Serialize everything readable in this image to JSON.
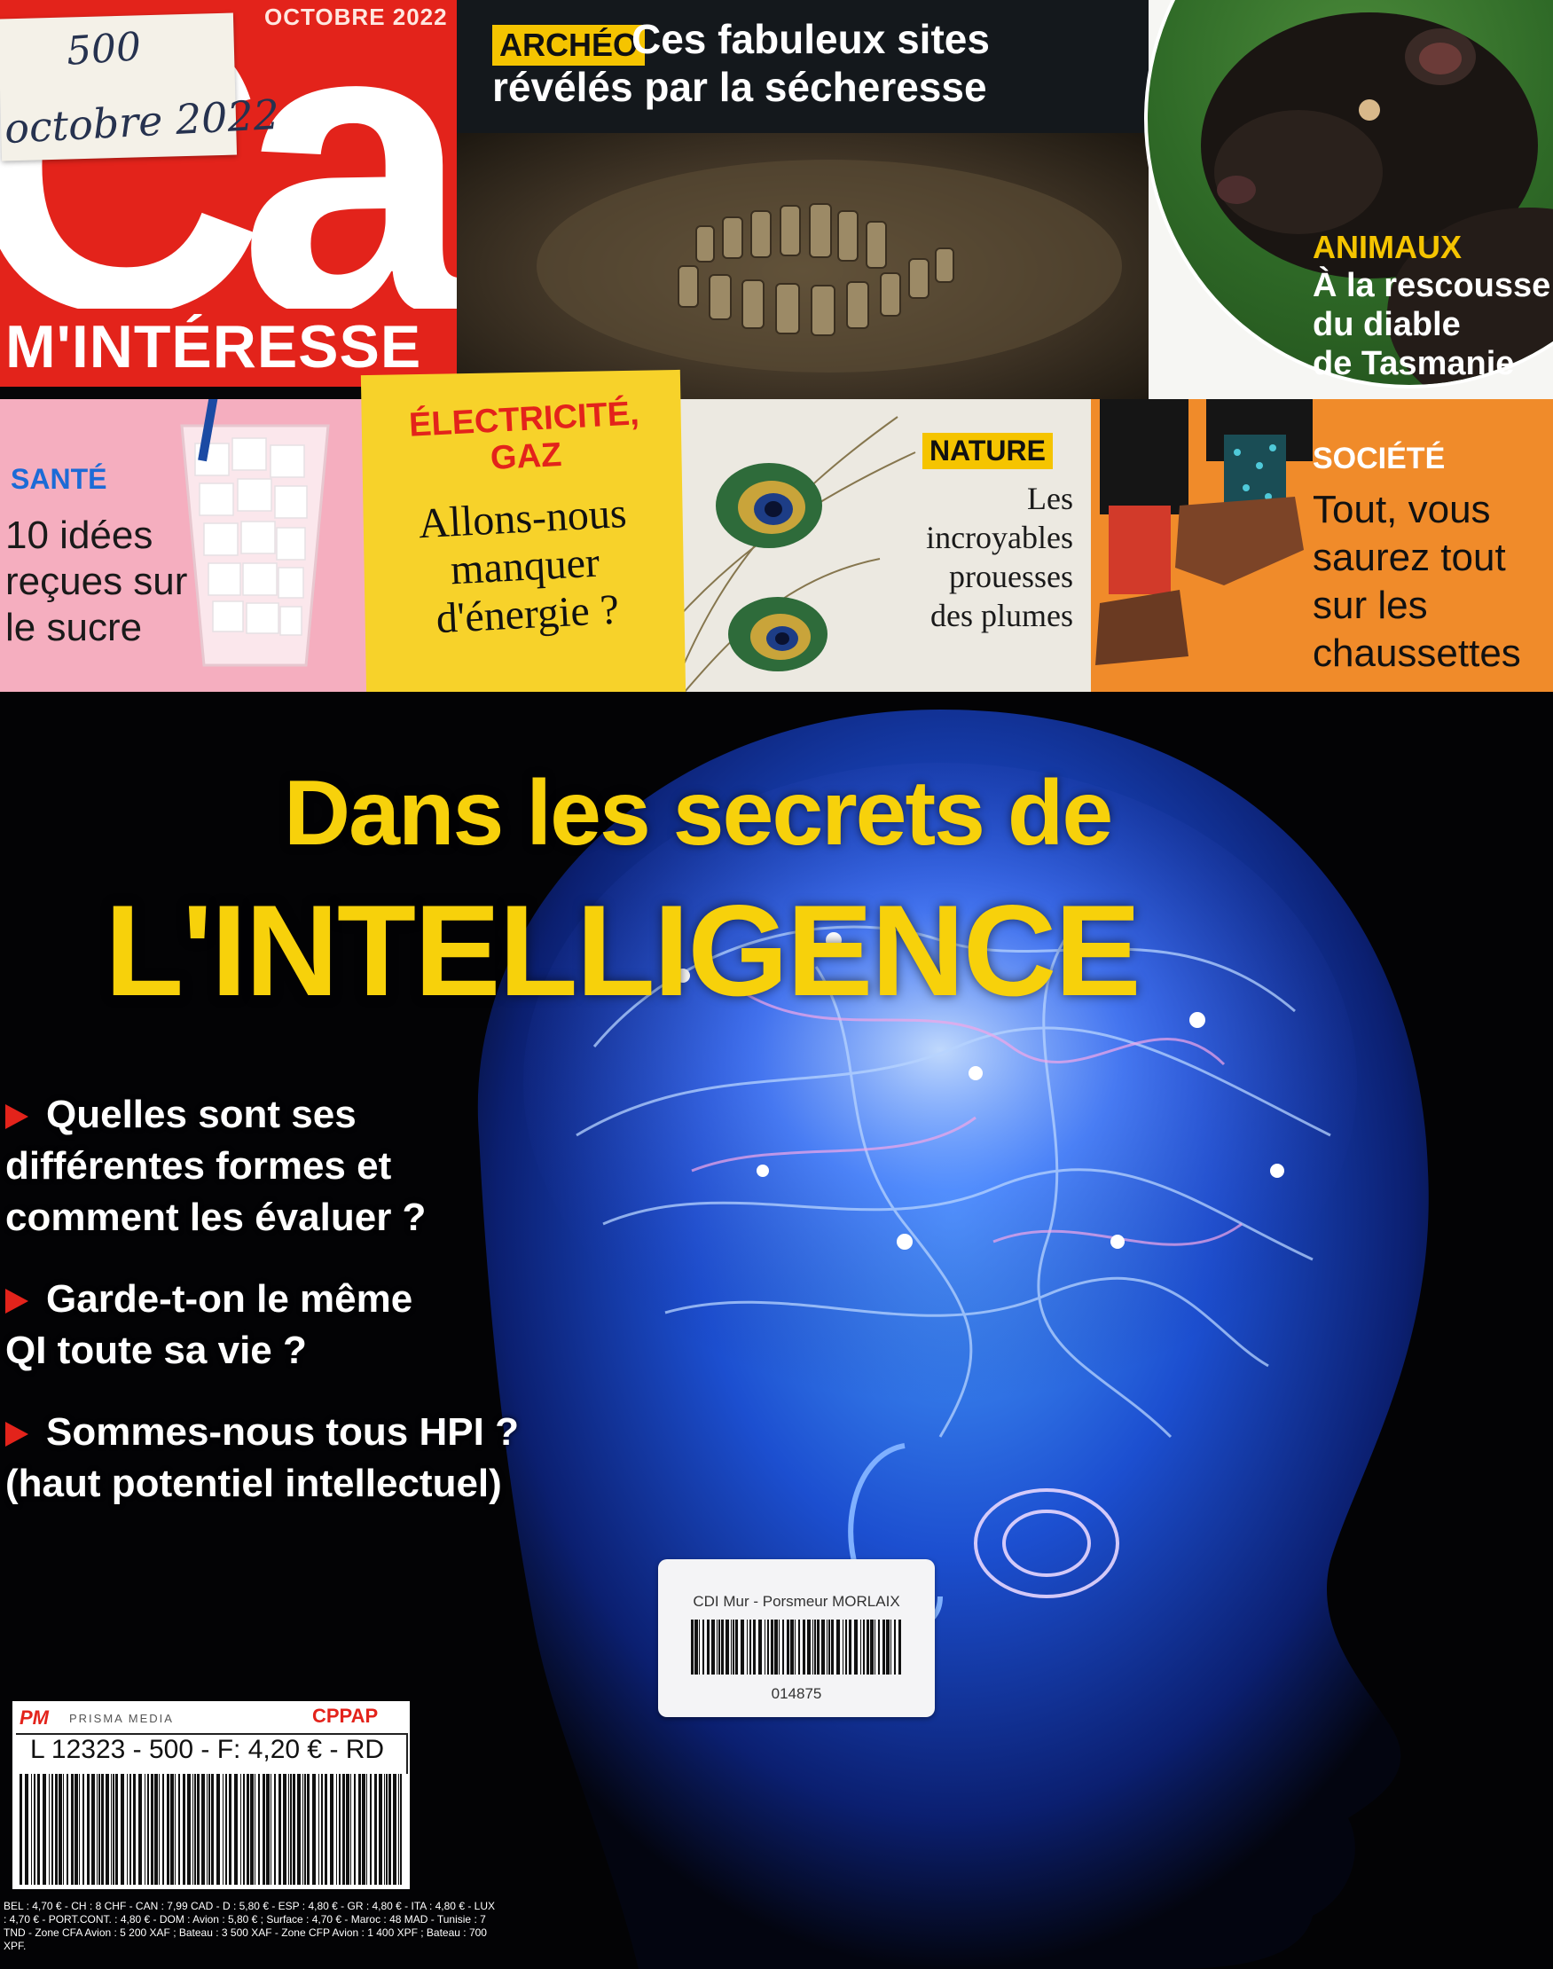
{
  "magazine": {
    "logo_letters": "Ça",
    "logo_sub": "M'INTÉRESSE",
    "issue_date": "OCTOBRE 2022"
  },
  "sticker": {
    "line1": "500",
    "line2": "octobre 2022"
  },
  "archeo": {
    "tag": "ARCHÉO",
    "title_line1": "Ces fabuleux sites",
    "title_line2": "révélés par la sécheresse"
  },
  "animaux": {
    "tag": "ANIMAUX",
    "lines": [
      "À la rescousse",
      "du diable",
      "de Tasmanie"
    ]
  },
  "sante": {
    "tag": "SANTÉ",
    "lines": [
      "10 idées",
      "reçues sur",
      "le sucre"
    ]
  },
  "electricite": {
    "tag_lines": [
      "ÉLECTRICITÉ,",
      "GAZ"
    ],
    "lines": [
      "Allons-nous",
      "manquer",
      "d'énergie ?"
    ]
  },
  "nature": {
    "tag": "NATURE",
    "lines": [
      "Les",
      "incroyables",
      "prouesses",
      "des plumes"
    ]
  },
  "societe": {
    "tag": "SOCIÉTÉ",
    "lines": [
      "Tout, vous",
      "saurez tout",
      "sur les",
      "chaussettes"
    ]
  },
  "headline": {
    "line1": "Dans les secrets de",
    "line2": "L'INTELLIGENCE"
  },
  "bullets": [
    {
      "lines": [
        "Quelles sont ses",
        "différentes formes et",
        "comment les évaluer ?"
      ]
    },
    {
      "lines": [
        "Garde-t-on le même",
        "QI toute sa vie ?"
      ]
    },
    {
      "lines": [
        "Sommes-nous tous HPI ?",
        "(haut potentiel intellectuel)"
      ]
    }
  ],
  "cdi_label": {
    "title": "CDI Mur - Porsmeur MORLAIX",
    "number": "014875"
  },
  "publisher_box": {
    "logo": "PM",
    "name": "PRISMA MEDIA",
    "cppap": "CPPAP",
    "price_line": "L 12323 - 500 - F: 4,20 € - RD"
  },
  "price_list": {
    "text": "BEL : 4,70 € - CH : 8 CHF - CAN : 7,99 CAD - D : 5,80 € - ESP : 4,80 € - GR : 4,80 € - ITA : 4,80 € - LUX : 4,70 € - PORT.CONT. : 4,80 € - DOM : Avion : 5,80 € ; Surface : 4,70 € - Maroc : 48 MAD - Tunisie : 7 TND - Zone CFA Avion : 5 200 XAF ; Bateau : 3 500 XAF - Zone CFP Avion : 1 400 XPF ; Bateau : 700 XPF."
  },
  "colors": {
    "brand_red": "#e3231b",
    "headline_yellow": "#f7d10b",
    "tag_yellow": "#f5c400",
    "sante_pink": "#f5aebf",
    "societe_orange": "#f08b2a"
  }
}
